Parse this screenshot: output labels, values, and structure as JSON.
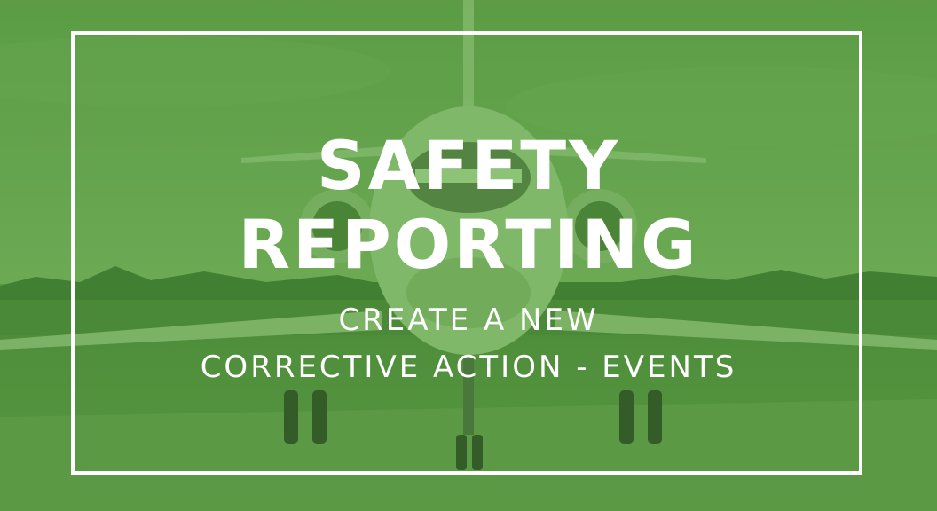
{
  "banner": {
    "title_line1": "SAFETY",
    "title_line2": "REPORTING",
    "subtitle_line1": "CREATE A NEW",
    "subtitle_line2": "CORRECTIVE ACTION - EVENTS"
  },
  "colors": {
    "overlay_green": "#5a9a44",
    "text": "#ffffff",
    "frame": "#ffffff"
  },
  "background_image": "jet-on-runway-photo"
}
